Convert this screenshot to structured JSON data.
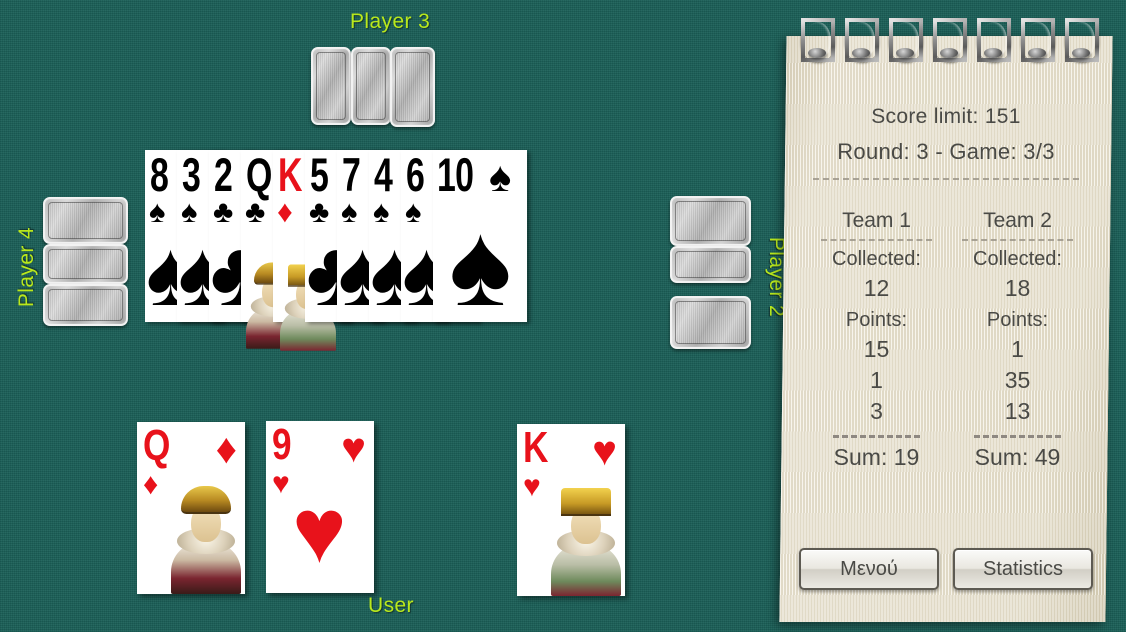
{
  "table": {
    "felt_color": "#1b6058",
    "label_color": "#b9e81c"
  },
  "players": {
    "top": {
      "name": "Player 3",
      "cards_face_down": 3
    },
    "left": {
      "name": "Player 4",
      "cards_face_down": 3
    },
    "right": {
      "name": "Player 2",
      "cards_face_down": 3
    },
    "bottom": {
      "name": "User"
    }
  },
  "hand": {
    "cards": [
      {
        "rank": "8",
        "suit": "♠",
        "color": "black"
      },
      {
        "rank": "3",
        "suit": "♠",
        "color": "black"
      },
      {
        "rank": "2",
        "suit": "♣",
        "color": "black"
      },
      {
        "rank": "Q",
        "suit": "♣",
        "color": "black"
      },
      {
        "rank": "K",
        "suit": "♦",
        "color": "red"
      },
      {
        "rank": "5",
        "suit": "♣",
        "color": "black"
      },
      {
        "rank": "7",
        "suit": "♠",
        "color": "black"
      },
      {
        "rank": "4",
        "suit": "♠",
        "color": "black"
      },
      {
        "rank": "6",
        "suit": "♠",
        "color": "black"
      },
      {
        "rank": "10",
        "suit": "♠",
        "color": "black"
      }
    ]
  },
  "played_cards": [
    {
      "rank": "Q",
      "suit": "♦",
      "color": "red",
      "court": "queen"
    },
    {
      "rank": "9",
      "suit": "♥",
      "color": "red",
      "court": "none"
    },
    {
      "rank": "K",
      "suit": "♥",
      "color": "red",
      "court": "king"
    }
  ],
  "scorepad": {
    "score_limit": "Score limit: 151",
    "round_game": "Round: 3 - Game: 3/3",
    "team1": {
      "name": "Team 1",
      "collected_label": "Collected:",
      "collected": "12",
      "points_label": "Points:",
      "points": [
        "15",
        "1",
        "3"
      ],
      "sum": "Sum: 19"
    },
    "team2": {
      "name": "Team 2",
      "collected_label": "Collected:",
      "collected": "18",
      "points_label": "Points:",
      "points": [
        "1",
        "35",
        "13"
      ],
      "sum": "Sum: 49"
    },
    "buttons": {
      "menu": "Μενού",
      "statistics": "Statistics"
    },
    "rings": 7,
    "paper_color": "#e9e3d1"
  }
}
